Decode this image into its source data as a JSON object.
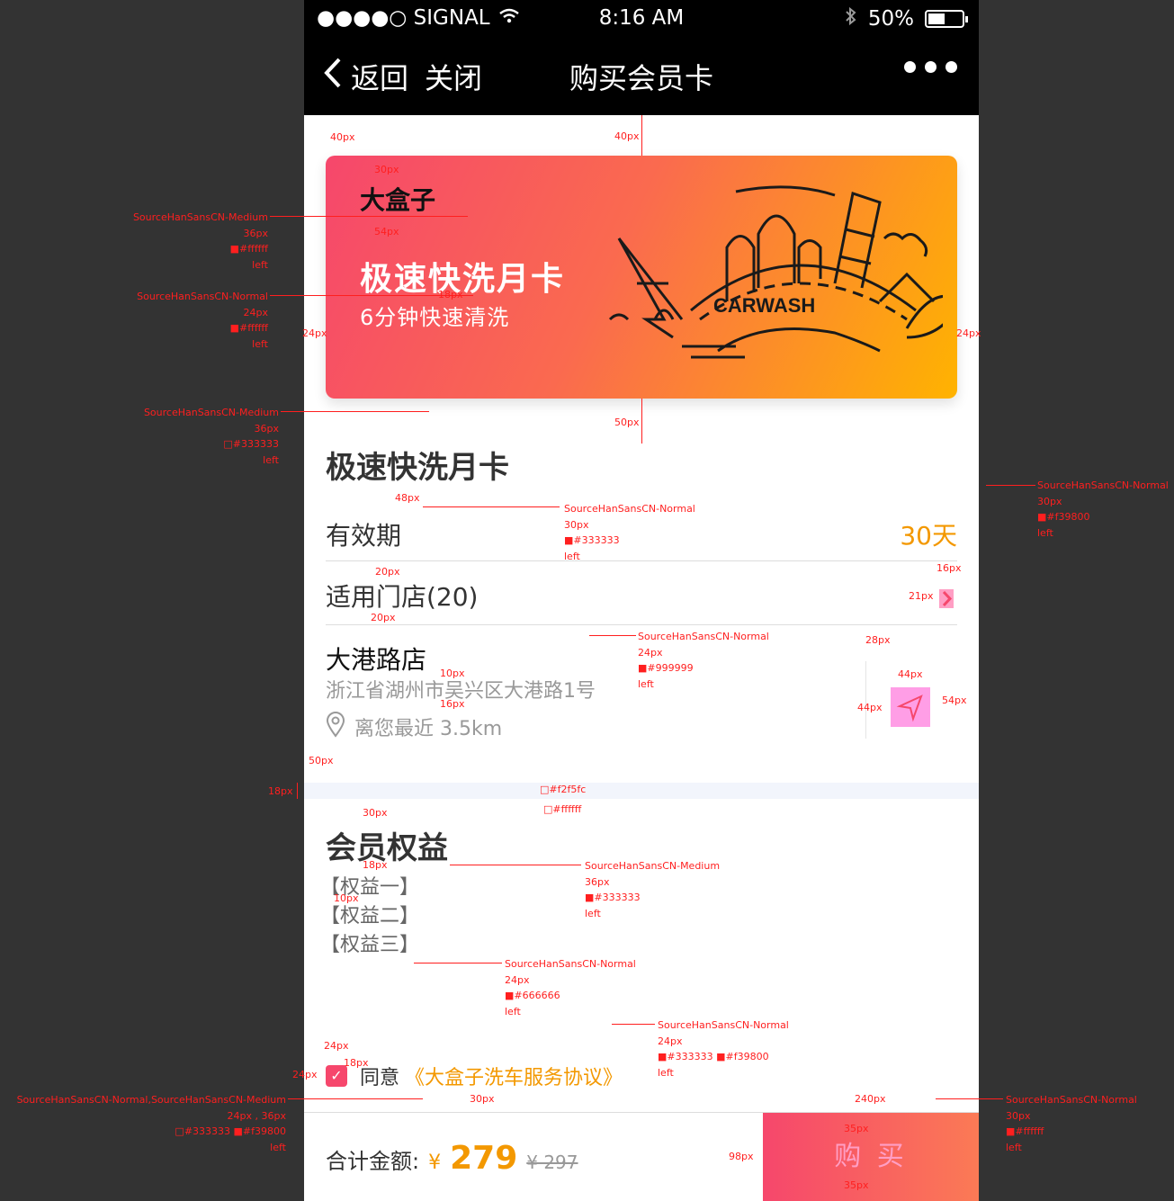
{
  "statusbar": {
    "signal": "●●●●○ SIGNAL",
    "time": "8:16 AM",
    "battery": "50%",
    "battery_level": 0.5
  },
  "navbar": {
    "back": "返回",
    "close": "关闭",
    "title": "购买会员卡"
  },
  "card": {
    "brand": "大盒子",
    "title": "极速快洗月卡",
    "subtitle": "6分钟快速清洗",
    "illustration_text": "CARWASH"
  },
  "product": {
    "title": "极速快洗月卡",
    "validity_label": "有效期",
    "validity_value": "30天",
    "stores_label": "适用门店(20)"
  },
  "store": {
    "name": "大港路店",
    "address": "浙江省湖州市吴兴区大港路1号",
    "distance": "离您最近 3.5km"
  },
  "benefits": {
    "title": "会员权益",
    "items": [
      "【权益一】",
      "【权益二】",
      "【权益三】"
    ]
  },
  "agreement": {
    "text": "同意",
    "link": "《大盒子洗车服务协议》"
  },
  "footer": {
    "total_label": "合计金额:",
    "currency": "¥",
    "price": "279",
    "old_price": "¥ 297",
    "buy": "购 买"
  },
  "colors": {
    "accent": "#f39800",
    "text": "#333333",
    "gray": "#999999",
    "bg_gap": "#f2f5fc",
    "gradient_start": "#f6476c",
    "gradient_end": "#ffb300"
  },
  "annotations": {
    "card_title_font": "SourceHanSansCN-Medium\n36px\n■#ffffff\nleft",
    "card_sub_font": "SourceHanSansCN-Normal\n24px\n■#ffffff\nleft",
    "title_font": "SourceHanSansCN-Medium\n36px\n□#333333\nleft",
    "validity_label_font": "SourceHanSansCN-Normal\n30px\n■#333333\nleft",
    "validity_value_font": "SourceHanSansCN-Normal\n30px\n■#f39800\nleft",
    "addr_font": "SourceHanSansCN-Normal\n24px\n■#999999\nleft",
    "gap_color": "□#f2f5fc",
    "white_color": "□#ffffff",
    "benefits_title_font": "SourceHanSansCN-Medium\n36px\n■#333333\nleft",
    "benefits_item_font": "SourceHanSansCN-Normal\n24px\n■#666666\nleft",
    "agree_font": "SourceHanSansCN-Normal\n24px\n■#333333 ■#f39800\nleft",
    "price_font": "SourceHanSansCN-Normal,SourceHanSansCN-Medium\n24px , 36px\n□#333333 ■#f39800\nleft",
    "buy_font": "SourceHanSansCN-Normal\n30px\n■#ffffff\nleft",
    "dims": [
      "40px",
      "40px",
      "30px",
      "54px",
      "18px",
      "24px",
      "24px",
      "50px",
      "48px",
      "20px",
      "20px",
      "16px",
      "21px",
      "10px",
      "16px",
      "28px",
      "44px",
      "44px",
      "54px",
      "50px",
      "18px",
      "30px",
      "18px",
      "10px",
      "24px",
      "18px",
      "24px",
      "30px",
      "240px",
      "35px",
      "35px",
      "98px"
    ]
  }
}
